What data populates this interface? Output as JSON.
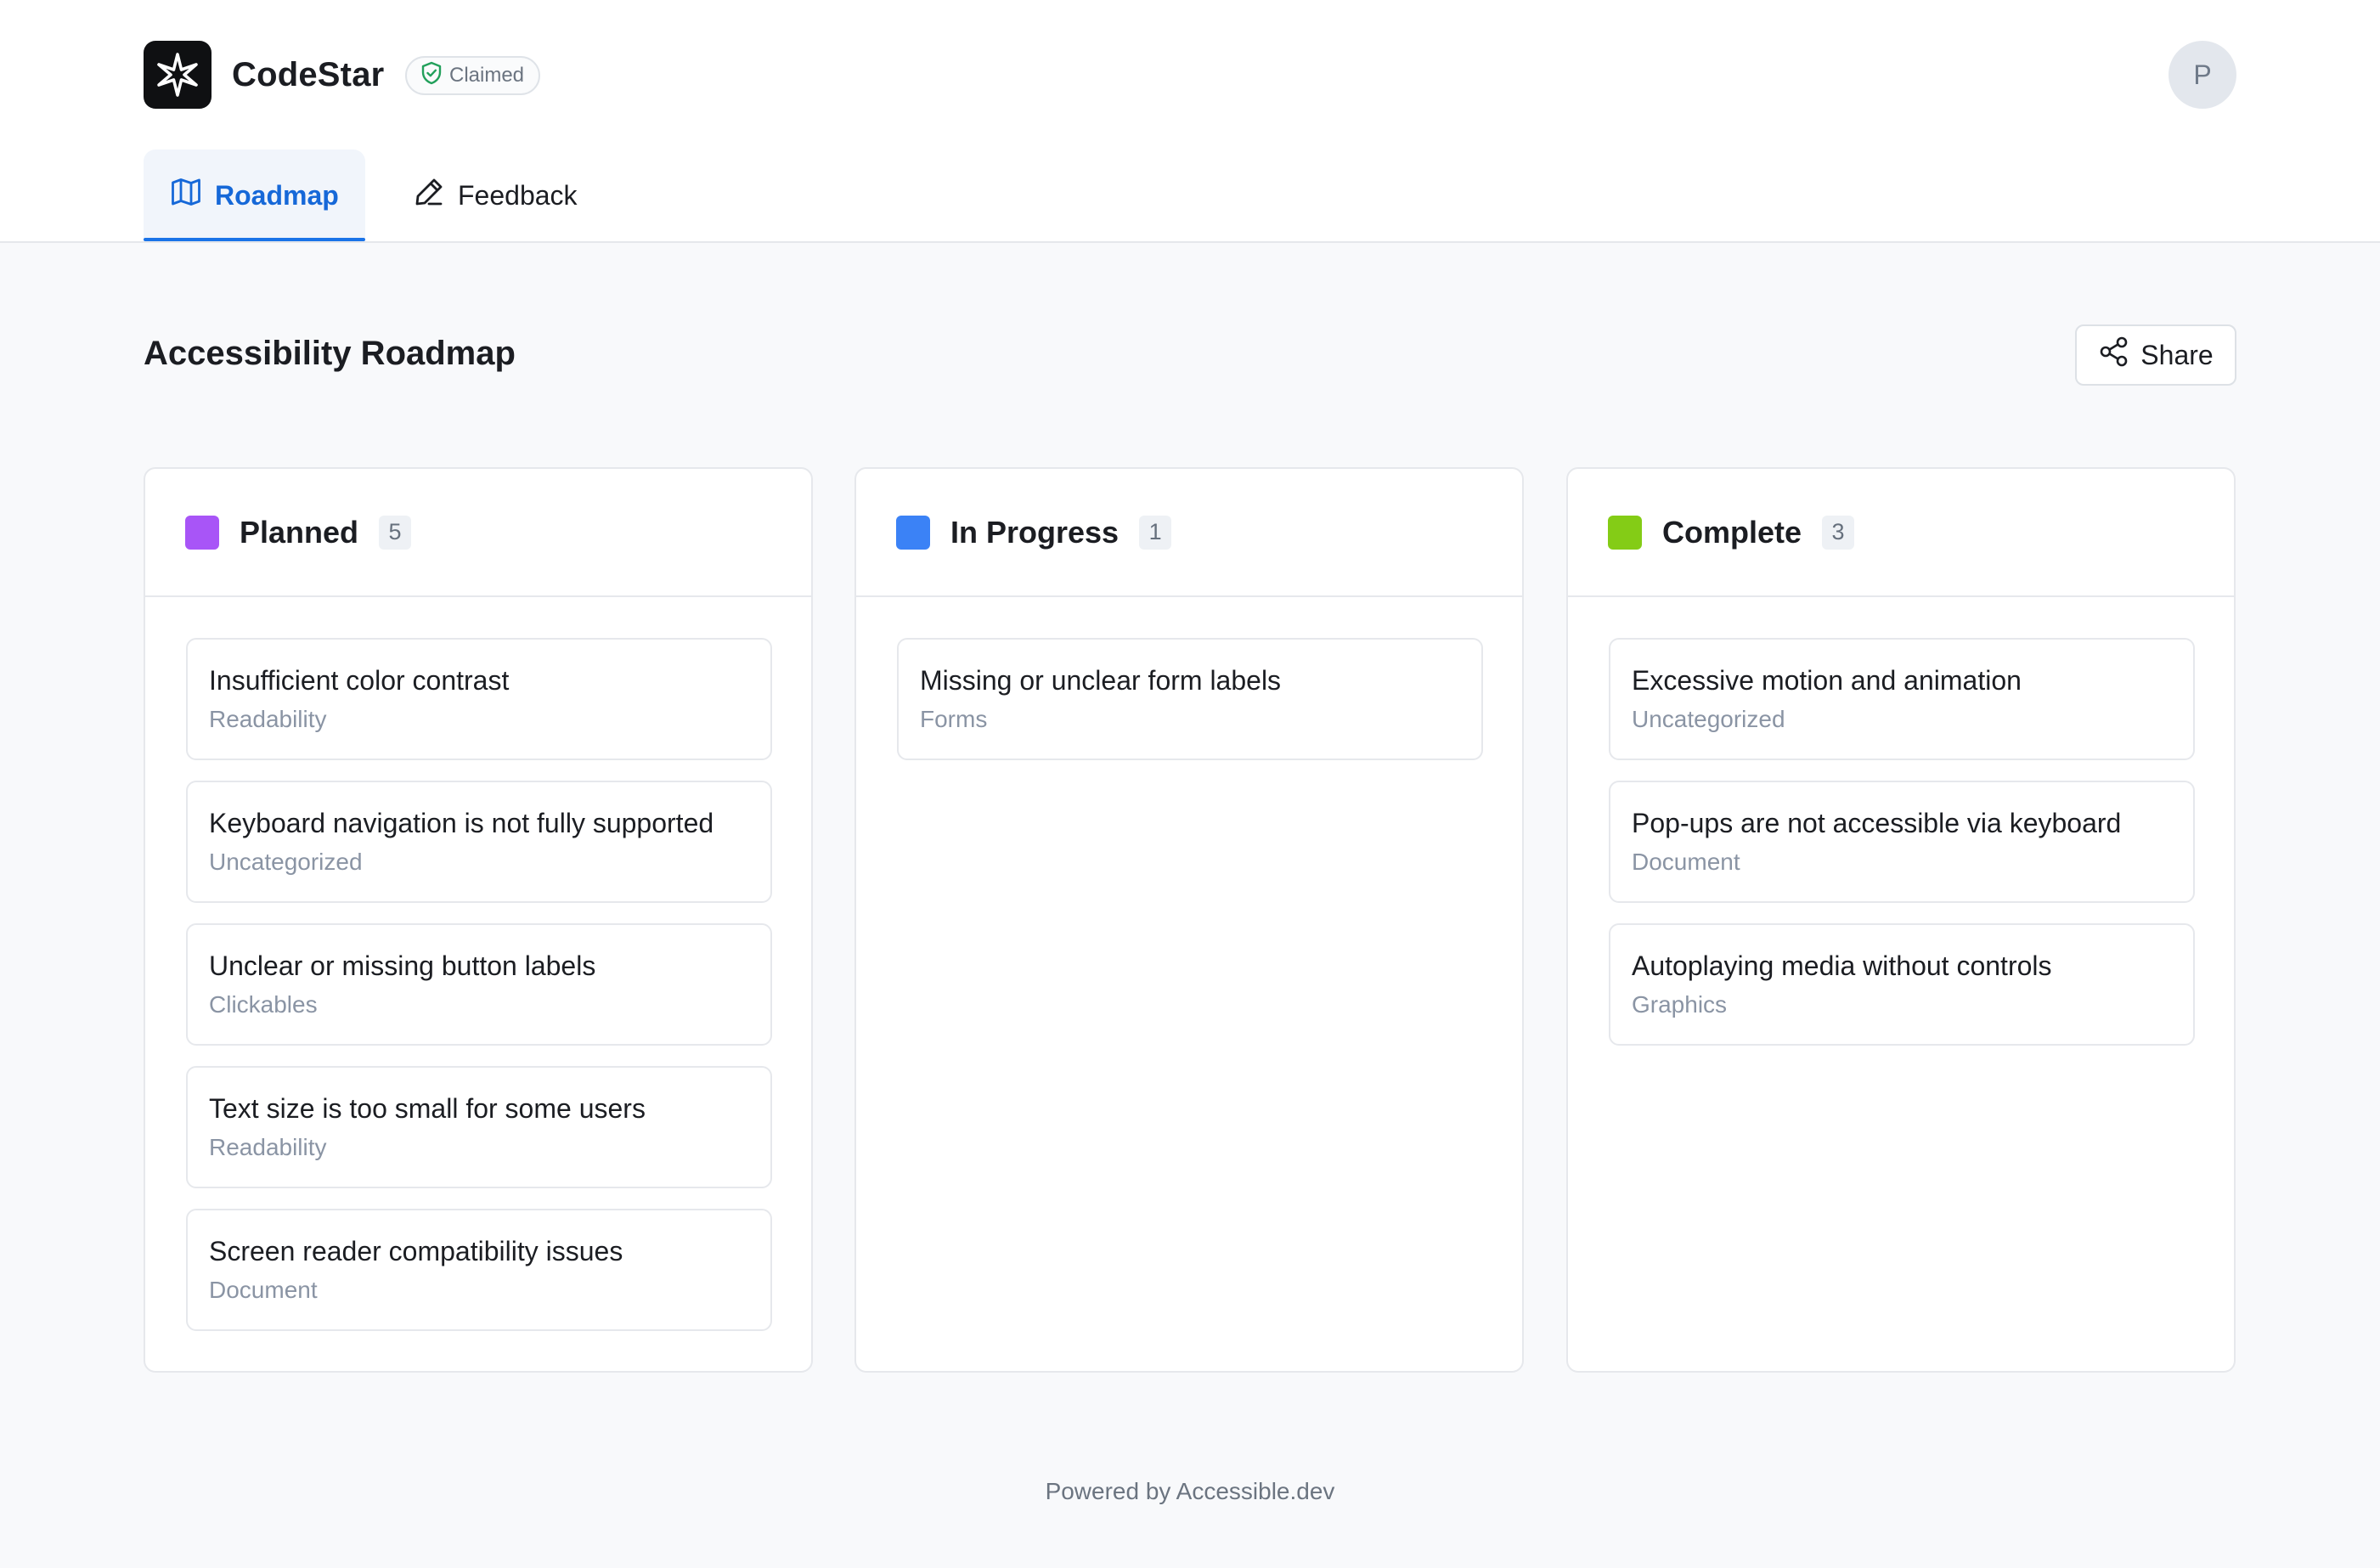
{
  "brand": {
    "name": "CodeStar",
    "badge": "Claimed",
    "logo_icon": "sparkle-star-icon"
  },
  "user": {
    "avatar_initial": "P"
  },
  "tabs": [
    {
      "label": "Roadmap",
      "icon": "map-icon",
      "active": true
    },
    {
      "label": "Feedback",
      "icon": "pencil-icon",
      "active": false
    }
  ],
  "page": {
    "title": "Accessibility Roadmap",
    "share_label": "Share"
  },
  "columns": [
    {
      "title": "Planned",
      "count": "5",
      "color": "#a855f7",
      "items": [
        {
          "title": "Insufficient color contrast",
          "category": "Readability"
        },
        {
          "title": "Keyboard navigation is not fully supported",
          "category": "Uncategorized"
        },
        {
          "title": "Unclear or missing button labels",
          "category": "Clickables"
        },
        {
          "title": "Text size is too small for some users",
          "category": "Readability"
        },
        {
          "title": "Screen reader compatibility issues",
          "category": "Document"
        }
      ]
    },
    {
      "title": "In Progress",
      "count": "1",
      "color": "#3b82f6",
      "items": [
        {
          "title": "Missing or unclear form labels",
          "category": "Forms"
        }
      ]
    },
    {
      "title": "Complete",
      "count": "3",
      "color": "#84cc16",
      "items": [
        {
          "title": "Excessive motion and animation",
          "category": "Uncategorized"
        },
        {
          "title": "Pop-ups are not accessible via keyboard",
          "category": "Document"
        },
        {
          "title": "Autoplaying media without controls",
          "category": "Graphics"
        }
      ]
    }
  ],
  "footer": {
    "text": "Powered by Accessible.dev"
  }
}
